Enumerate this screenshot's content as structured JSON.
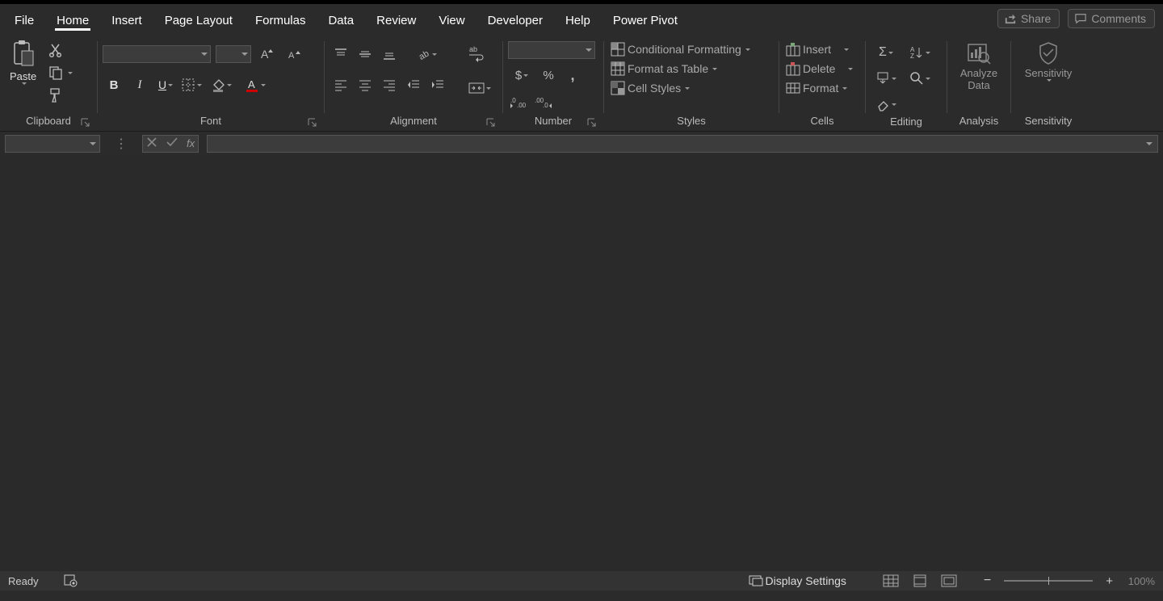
{
  "tabs": [
    "File",
    "Home",
    "Insert",
    "Page Layout",
    "Formulas",
    "Data",
    "Review",
    "View",
    "Developer",
    "Help",
    "Power Pivot"
  ],
  "active_tab": 1,
  "header": {
    "share": "Share",
    "comments": "Comments"
  },
  "ribbon": {
    "clipboard": {
      "label": "Clipboard",
      "paste": "Paste"
    },
    "font": {
      "label": "Font",
      "font_name": "",
      "font_size": ""
    },
    "alignment": {
      "label": "Alignment"
    },
    "number": {
      "label": "Number",
      "format": ""
    },
    "styles": {
      "label": "Styles",
      "cond": "Conditional Formatting",
      "table": "Format as Table",
      "cell": "Cell Styles"
    },
    "cells": {
      "label": "Cells",
      "insert": "Insert",
      "delete": "Delete",
      "format": "Format"
    },
    "editing": {
      "label": "Editing"
    },
    "analysis": {
      "label": "Analysis",
      "analyze1": "Analyze",
      "analyze2": "Data"
    },
    "sensitivity": {
      "label": "Sensitivity",
      "btn": "Sensitivity"
    }
  },
  "namebox": "",
  "formula": "",
  "status": {
    "ready": "Ready",
    "display": "Display Settings",
    "zoom": "100%"
  }
}
